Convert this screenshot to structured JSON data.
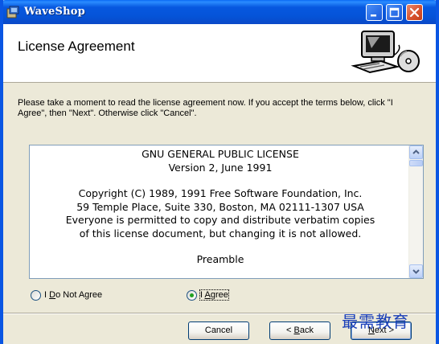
{
  "window": {
    "title": "WaveShop"
  },
  "header": {
    "title": "License Agreement"
  },
  "instructions": "Please take a moment to read the license agreement now. If you accept the terms below, click \"I Agree\", then \"Next\". Otherwise click \"Cancel\".",
  "license": {
    "paragraphs": [
      [
        "GNU GENERAL PUBLIC LICENSE",
        "Version 2, June 1991"
      ],
      [
        "Copyright (C) 1989, 1991 Free Software Foundation, Inc.",
        "59 Temple Place, Suite 330, Boston, MA 02111-1307 USA",
        "Everyone is permitted to copy and distribute verbatim copies",
        "of this license document, but changing it is not allowed."
      ],
      [
        "Preamble"
      ]
    ]
  },
  "options": {
    "do_not_agree": {
      "prefix": "I ",
      "accel": "D",
      "rest": "o Not Agree",
      "selected": false
    },
    "agree": {
      "prefix": "I ",
      "accel": "A",
      "rest": "gree",
      "selected": true
    }
  },
  "buttons": {
    "cancel": "Cancel",
    "back": {
      "prefix": "< ",
      "accel": "B",
      "rest": "ack"
    },
    "next": {
      "accel": "N",
      "rest": "ext >"
    }
  },
  "watermark": "最需教育",
  "colors": {
    "titlebar": "#0553d7",
    "frame": "#0a56e3",
    "dialog_bg": "#ece9d8",
    "close_button": "#d8532f",
    "radio_selected": "#21a121"
  },
  "icons": {
    "app": "installer-icon",
    "header_graphic": "computer-with-disc-icon",
    "minimize": "minimize-icon",
    "maximize": "maximize-icon",
    "close": "close-icon",
    "scroll_up": "chevron-up-icon",
    "scroll_down": "chevron-down-icon"
  }
}
